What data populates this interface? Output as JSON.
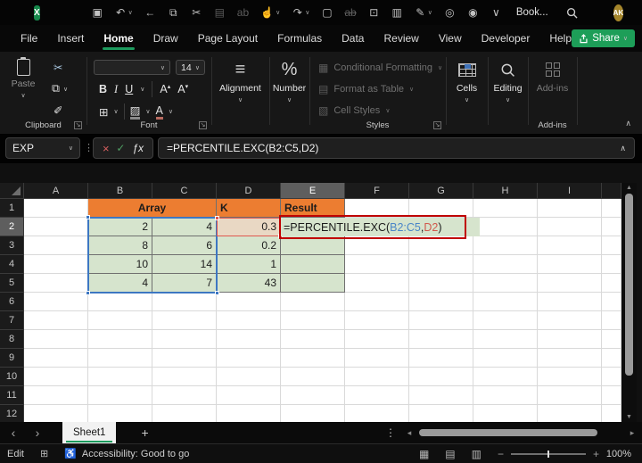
{
  "titlebar": {
    "title": "Book...",
    "avatar": "AK",
    "icons": [
      {
        "name": "excel-logo",
        "glyph": "X"
      },
      {
        "name": "save-icon",
        "glyph": "▣"
      },
      {
        "name": "undo-icon",
        "glyph": "↶",
        "drop": true
      },
      {
        "name": "back-icon",
        "glyph": "←"
      },
      {
        "name": "copy-icon",
        "glyph": "⧉"
      },
      {
        "name": "cut-icon",
        "glyph": "✂"
      },
      {
        "name": "paste-icon",
        "glyph": "▤",
        "dim": true
      },
      {
        "name": "replace-icon",
        "glyph": "ab",
        "dim": true
      },
      {
        "name": "touch-mode-icon",
        "glyph": "☝",
        "drop": true
      },
      {
        "name": "redo-icon",
        "glyph": "↷",
        "drop": true
      },
      {
        "name": "new-file-icon",
        "glyph": "▢"
      },
      {
        "name": "strikethrough-icon",
        "glyph": "ab",
        "dim": true,
        "strike": true
      },
      {
        "name": "camera-icon",
        "glyph": "⊡"
      },
      {
        "name": "workbook-stats-icon",
        "glyph": "▥"
      },
      {
        "name": "ink-icon",
        "glyph": "✎",
        "drop": true
      },
      {
        "name": "people-search-icon",
        "glyph": "◎"
      },
      {
        "name": "record-icon",
        "glyph": "◉"
      },
      {
        "name": "qat-overflow-icon",
        "glyph": "∨"
      }
    ],
    "window_buttons": [
      {
        "name": "minimize-button",
        "glyph": "─"
      },
      {
        "name": "maximize-button",
        "glyph": "□"
      },
      {
        "name": "close-button",
        "glyph": "×"
      }
    ]
  },
  "menubar": {
    "tabs": [
      "File",
      "Insert",
      "Home",
      "Draw",
      "Page Layout",
      "Formulas",
      "Data",
      "Review",
      "View",
      "Developer",
      "Help"
    ],
    "active_tab": "Home",
    "share_label": "Share"
  },
  "ribbon": {
    "clipboard": {
      "paste": "Paste",
      "label": "Clipboard"
    },
    "font": {
      "size": "14",
      "bold": "B",
      "italic": "I",
      "underline": "U",
      "label": "Font"
    },
    "alignment": {
      "icon": "≡",
      "label": "Alignment"
    },
    "number": {
      "icon": "%",
      "label": "Number"
    },
    "styles": {
      "conditional": "Conditional Formatting",
      "format_table": "Format as Table",
      "cell_styles": "Cell Styles",
      "label": "Styles"
    },
    "cells": {
      "label": "Cells"
    },
    "editing": {
      "label": "Editing"
    },
    "addins": {
      "button": "Add-ins",
      "label": "Add-ins"
    }
  },
  "formula_bar": {
    "name_box": "EXP",
    "formula": "=PERCENTILE.EXC(B2:C5,D2)"
  },
  "grid": {
    "columns": [
      "A",
      "B",
      "C",
      "D",
      "E",
      "F",
      "G",
      "H",
      "I"
    ],
    "rows": [
      "1",
      "2",
      "3",
      "4",
      "5",
      "6",
      "7",
      "8",
      "9",
      "10",
      "11",
      "12"
    ],
    "selected_col": "E",
    "selected_row": "2",
    "cells": [
      {
        "ref": "B1",
        "span": 2,
        "text": "Array",
        "fill": "orange",
        "align": "center",
        "bold": true
      },
      {
        "ref": "D1",
        "text": "K",
        "fill": "orange",
        "align": "left",
        "bold": true
      },
      {
        "ref": "E1",
        "text": "Result",
        "fill": "orange",
        "align": "left",
        "bold": true
      },
      {
        "ref": "B2",
        "text": "2",
        "fill": "green"
      },
      {
        "ref": "C2",
        "text": "4",
        "fill": "green"
      },
      {
        "ref": "D2",
        "text": "0.3",
        "fill": "tan"
      },
      {
        "ref": "E2",
        "text": "",
        "fill": "green"
      },
      {
        "ref": "B3",
        "text": "8",
        "fill": "green"
      },
      {
        "ref": "C3",
        "text": "6",
        "fill": "green"
      },
      {
        "ref": "D3",
        "text": "0.2",
        "fill": "green"
      },
      {
        "ref": "E3",
        "text": "",
        "fill": "green"
      },
      {
        "ref": "B4",
        "text": "10",
        "fill": "green"
      },
      {
        "ref": "C4",
        "text": "14",
        "fill": "green"
      },
      {
        "ref": "D4",
        "text": "1",
        "fill": "green"
      },
      {
        "ref": "E4",
        "text": "",
        "fill": "green"
      },
      {
        "ref": "B5",
        "text": "4",
        "fill": "green"
      },
      {
        "ref": "C5",
        "text": "7",
        "fill": "green"
      },
      {
        "ref": "D5",
        "text": "43",
        "fill": "green"
      },
      {
        "ref": "E5",
        "text": "",
        "fill": "green"
      }
    ],
    "formula_cell": {
      "ref": "E2",
      "segments": [
        {
          "text": "=PERCENTILE.EXC(",
          "color": "#1b1b1b"
        },
        {
          "text": "B2:C5",
          "color": "#4a86c8"
        },
        {
          "text": ",",
          "color": "#1b1b1b"
        },
        {
          "text": "D2",
          "color": "#d1584c"
        },
        {
          "text": ")",
          "color": "#1b1b1b"
        }
      ]
    }
  },
  "sheet_bar": {
    "tab_name": "Sheet1",
    "add_label": "+"
  },
  "status_bar": {
    "mode": "Edit",
    "accessibility": "Accessibility: Good to go",
    "zoom": "100%",
    "view_icons": [
      {
        "name": "normal-view-icon",
        "glyph": "▦"
      },
      {
        "name": "page-layout-view-icon",
        "glyph": "▤"
      },
      {
        "name": "page-break-view-icon",
        "glyph": "▥"
      }
    ]
  },
  "colors": {
    "orange": "#EC7D31",
    "green": "#D6E4CD",
    "tan": "#E9D8C4",
    "accent_green": "#1D9B5E",
    "range_blue": "#3D77C2",
    "ref_red": "#E0574F",
    "box_red": "#C00000"
  }
}
